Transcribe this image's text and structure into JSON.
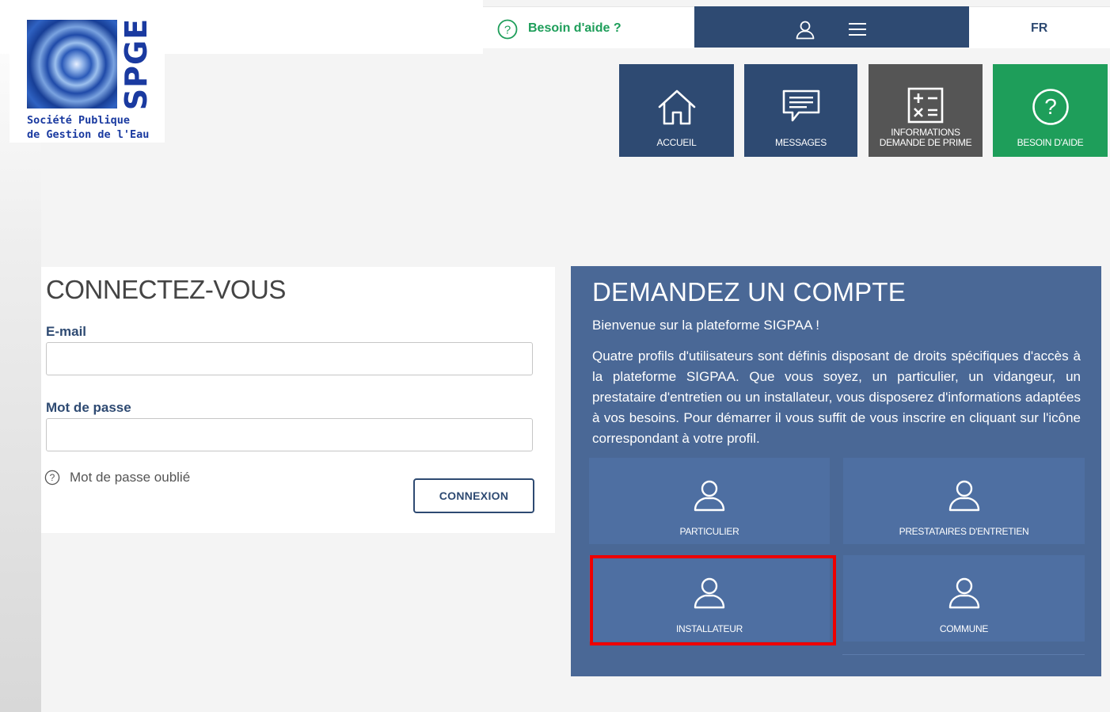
{
  "logo": {
    "brand": "SPGE",
    "line1": "Société Publique",
    "line2": "de Gestion de l'Eau"
  },
  "topbar": {
    "help_label": "Besoin d'aide ?",
    "language": "FR"
  },
  "tiles": [
    {
      "label": "ACCUEIL",
      "icon": "home-icon",
      "color": "#2e4a72"
    },
    {
      "label": "MESSAGES",
      "icon": "message-icon",
      "color": "#2e4a72"
    },
    {
      "label1": "INFORMATIONS",
      "label2": "DEMANDE DE PRIME",
      "icon": "calculator-icon",
      "color": "#555555"
    },
    {
      "label": "BESOIN D'AIDE",
      "icon": "help-icon",
      "color": "#1e9e5a"
    }
  ],
  "login": {
    "title": "CONNECTEZ-VOUS",
    "email_label": "E-mail",
    "email_value": "",
    "password_label": "Mot de passe",
    "password_value": "",
    "forgot_label": "Mot de passe oublié",
    "submit_label": "CONNEXION"
  },
  "request": {
    "title": "DEMANDEZ UN COMPTE",
    "welcome": "Bienvenue sur la plateforme SIGPAA !",
    "description": "Quatre profils d'utilisateurs sont définis disposant de droits spécifiques d'accès à la plateforme SIGPAA. Que vous soyez, un particulier, un vidangeur, un prestataire d'entretien ou un installateur, vous disposerez d'informations adaptées à vos besoins. Pour démarrer il vous suffit de vous inscrire en cliquant sur l'icône correspondant à votre profil.",
    "profiles": [
      {
        "label": "PARTICULIER",
        "icon": "user-icon"
      },
      {
        "label": "PRESTATAIRES D'ENTRETIEN",
        "icon": "user-icon"
      },
      {
        "label": "INSTALLATEUR",
        "icon": "user-icon",
        "highlighted": true
      },
      {
        "label": "COMMUNE",
        "icon": "user-icon"
      }
    ]
  },
  "colors": {
    "navy": "#2e4a72",
    "panel_blue": "#4a6896",
    "profile_tile": "#4e6fa2",
    "green": "#1e9e5a",
    "highlight": "#ee0000"
  }
}
